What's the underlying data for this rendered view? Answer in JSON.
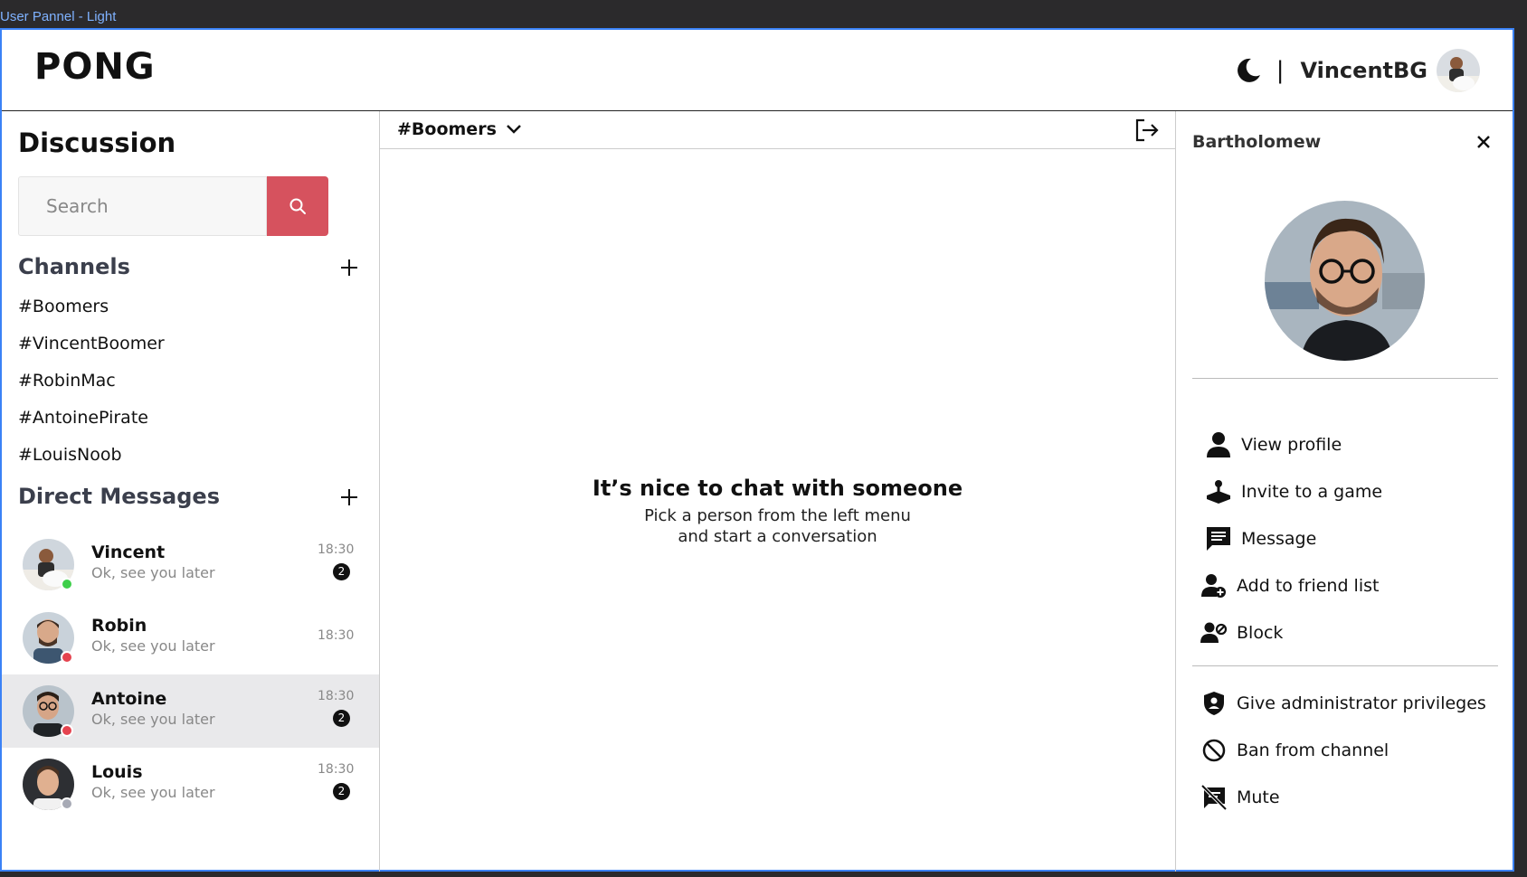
{
  "frame_label": "User Pannel - Light",
  "header": {
    "logo": "PONG",
    "separator": "|",
    "username": "VincentBG"
  },
  "left": {
    "title": "Discussion",
    "search_placeholder": "Search",
    "channels_title": "Channels",
    "channels": [
      "#Boomers",
      "#VincentBoomer",
      "#RobinMac",
      "#AntoinePirate",
      "#LouisNoob"
    ],
    "dm_title": "Direct Messages",
    "dms": [
      {
        "name": "Vincent",
        "message": "Ok, see you later",
        "time": "18:30",
        "badge": "2",
        "status_color": "#3ecf4a",
        "active": false
      },
      {
        "name": "Robin",
        "message": "Ok, see you later",
        "time": "18:30",
        "badge": "",
        "status_color": "#e5434f",
        "active": false
      },
      {
        "name": "Antoine",
        "message": "Ok, see you later",
        "time": "18:30",
        "badge": "2",
        "status_color": "#e5434f",
        "active": true
      },
      {
        "name": "Louis",
        "message": "Ok, see you later",
        "time": "18:30",
        "badge": "2",
        "status_color": "#a7aab5",
        "active": false
      }
    ]
  },
  "center": {
    "channel": "#Boomers",
    "empty_title": "It’s nice to chat with someone",
    "empty_line1": "Pick a person from the left menu",
    "empty_line2": "and start a conversation"
  },
  "right": {
    "name": "Bartholomew",
    "actions": [
      "View profile",
      "Invite to a game",
      "Message",
      "Add to friend list",
      "Block"
    ],
    "admin_actions": [
      "Give administrator privileges",
      "Ban from channel",
      "Mute"
    ]
  },
  "colors": {
    "accent": "#d6525e",
    "online": "#3ecf4a",
    "busy": "#e5434f",
    "offline": "#a7aab5",
    "frame": "#3b82f6"
  }
}
